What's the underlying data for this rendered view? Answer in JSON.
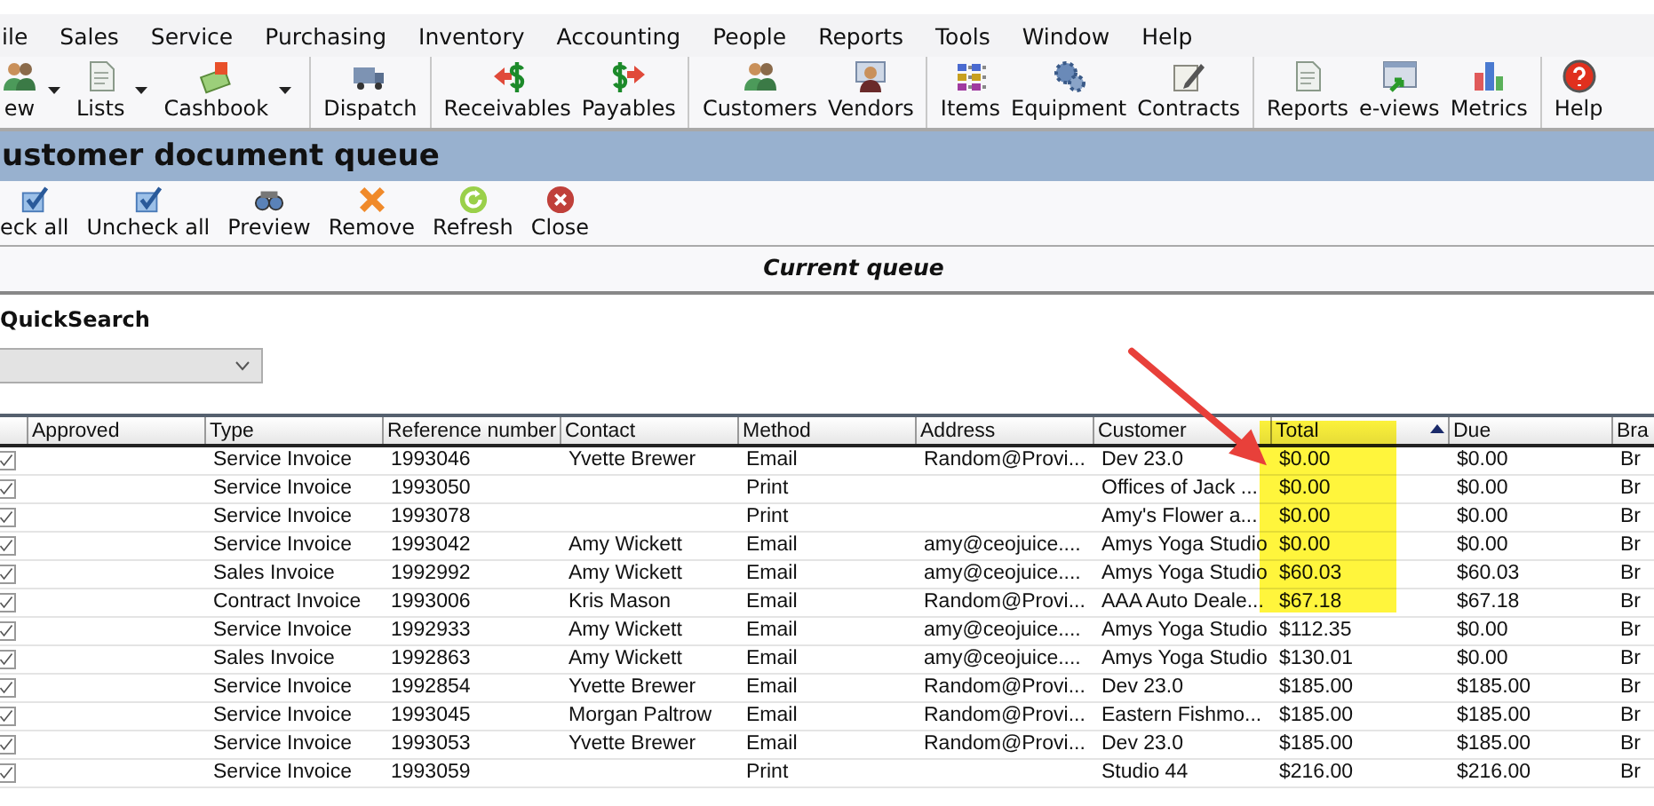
{
  "menu": [
    "ile",
    "Sales",
    "Service",
    "Purchasing",
    "Inventory",
    "Accounting",
    "People",
    "Reports",
    "Tools",
    "Window",
    "Help"
  ],
  "toolbar": {
    "groups": [
      [
        {
          "label": "ew",
          "kind": "people",
          "dropdown": true
        },
        {
          "label": "Lists",
          "kind": "document",
          "dropdown": true
        },
        {
          "label": "Cashbook",
          "kind": "money",
          "dropdown": true
        }
      ],
      [
        {
          "label": "Dispatch",
          "kind": "truck",
          "dropdown": false
        }
      ],
      [
        {
          "label": "Receivables",
          "kind": "dollar-in",
          "dropdown": false
        },
        {
          "label": "Payables",
          "kind": "dollar-out",
          "dropdown": false
        }
      ],
      [
        {
          "label": "Customers",
          "kind": "people",
          "dropdown": false
        },
        {
          "label": "Vendors",
          "kind": "person",
          "dropdown": false
        }
      ],
      [
        {
          "label": "Items",
          "kind": "grid",
          "dropdown": false
        },
        {
          "label": "Equipment",
          "kind": "gears",
          "dropdown": false
        },
        {
          "label": "Contracts",
          "kind": "pencil",
          "dropdown": false
        }
      ],
      [
        {
          "label": "Reports",
          "kind": "document",
          "dropdown": false
        },
        {
          "label": "e-views",
          "kind": "window",
          "dropdown": false
        },
        {
          "label": "Metrics",
          "kind": "bars",
          "dropdown": false
        }
      ],
      [
        {
          "label": "Help",
          "kind": "help",
          "dropdown": false
        }
      ]
    ]
  },
  "window": {
    "title": "ustomer document queue"
  },
  "actions": [
    {
      "label": "eck all",
      "kind": "check"
    },
    {
      "label": "Uncheck all",
      "kind": "check"
    },
    {
      "label": "Preview",
      "kind": "glasses"
    },
    {
      "label": "Remove",
      "kind": "remove"
    },
    {
      "label": "Refresh",
      "kind": "refresh"
    },
    {
      "label": "Close",
      "kind": "close"
    }
  ],
  "queue_heading": "Current queue",
  "quick_search": {
    "label": "QuickSearch"
  },
  "table": {
    "columns": [
      {
        "label": "Approved",
        "sorted": false
      },
      {
        "label": "Type",
        "sorted": false
      },
      {
        "label": "Reference number",
        "sorted": false
      },
      {
        "label": "Contact",
        "sorted": false
      },
      {
        "label": "Method",
        "sorted": false
      },
      {
        "label": "Address",
        "sorted": false
      },
      {
        "label": "Customer",
        "sorted": false
      },
      {
        "label": "Total",
        "sorted": true
      },
      {
        "label": "Due",
        "sorted": false
      },
      {
        "label": "Bra",
        "sorted": false
      }
    ],
    "rows": [
      {
        "checked": true,
        "type": "Service Invoice",
        "reference_number": "1993046",
        "contact": "Yvette Brewer",
        "method": "Email",
        "address": "Random@Provi...",
        "customer": "Dev 23.0",
        "total": "$0.00",
        "due": "$0.00",
        "column_10": "Br"
      },
      {
        "checked": true,
        "type": "Service Invoice",
        "reference_number": "1993050",
        "method": "Print",
        "customer": "Offices of Jack ...",
        "total": "$0.00",
        "due": "$0.00",
        "column_10": "Br"
      },
      {
        "checked": true,
        "type": "Service Invoice",
        "reference_number": "1993078",
        "method": "Print",
        "customer": "Amy's Flower a...",
        "total": "$0.00",
        "due": "$0.00",
        "column_10": "Br"
      },
      {
        "checked": true,
        "type": "Service Invoice",
        "reference_number": "1993042",
        "contact": "Amy Wickett",
        "method": "Email",
        "address": "amy@ceojuice....",
        "customer": "Amys Yoga Studio",
        "total": "$0.00",
        "due": "$0.00",
        "column_10": "Br"
      },
      {
        "checked": true,
        "type": "Sales Invoice",
        "reference_number": "1992992",
        "contact": "Amy Wickett",
        "method": "Email",
        "address": "amy@ceojuice....",
        "customer": "Amys Yoga Studio",
        "total": "$60.03",
        "due": "$60.03",
        "column_10": "Br"
      },
      {
        "checked": true,
        "type": "Contract Invoice",
        "reference_number": "1993006",
        "contact": "Kris Mason",
        "method": "Email",
        "address": "Random@Provi...",
        "customer": "AAA Auto Deale...",
        "total": "$67.18",
        "due": "$67.18",
        "column_10": "Br"
      },
      {
        "checked": true,
        "type": "Service Invoice",
        "reference_number": "1992933",
        "contact": "Amy Wickett",
        "method": "Email",
        "address": "amy@ceojuice....",
        "customer": "Amys Yoga Studio",
        "total": "$112.35",
        "due": "$0.00",
        "column_10": "Br"
      },
      {
        "checked": true,
        "type": "Sales Invoice",
        "reference_number": "1992863",
        "contact": "Amy Wickett",
        "method": "Email",
        "address": "amy@ceojuice....",
        "customer": "Amys Yoga Studio",
        "total": "$130.01",
        "due": "$0.00",
        "column_10": "Br"
      },
      {
        "checked": true,
        "type": "Service Invoice",
        "reference_number": "1992854",
        "contact": "Yvette Brewer",
        "method": "Email",
        "address": "Random@Provi...",
        "customer": "Dev 23.0",
        "total": "$185.00",
        "due": "$185.00",
        "column_10": "Br"
      },
      {
        "checked": true,
        "type": "Service Invoice",
        "reference_number": "1993045",
        "contact": "Morgan Paltrow",
        "method": "Email",
        "address": "Random@Provi...",
        "customer": "Eastern Fishmo...",
        "total": "$185.00",
        "due": "$185.00",
        "column_10": "Br"
      },
      {
        "checked": true,
        "type": "Service Invoice",
        "reference_number": "1993053",
        "contact": "Yvette Brewer",
        "method": "Email",
        "address": "Random@Provi...",
        "customer": "Dev 23.0",
        "total": "$185.00",
        "due": "$185.00",
        "column_10": "Br"
      },
      {
        "checked": true,
        "type": "Service Invoice",
        "reference_number": "1993059",
        "method": "Print",
        "customer": "Studio 44",
        "total": "$216.00",
        "due": "$216.00",
        "column_10": "Br"
      }
    ]
  }
}
